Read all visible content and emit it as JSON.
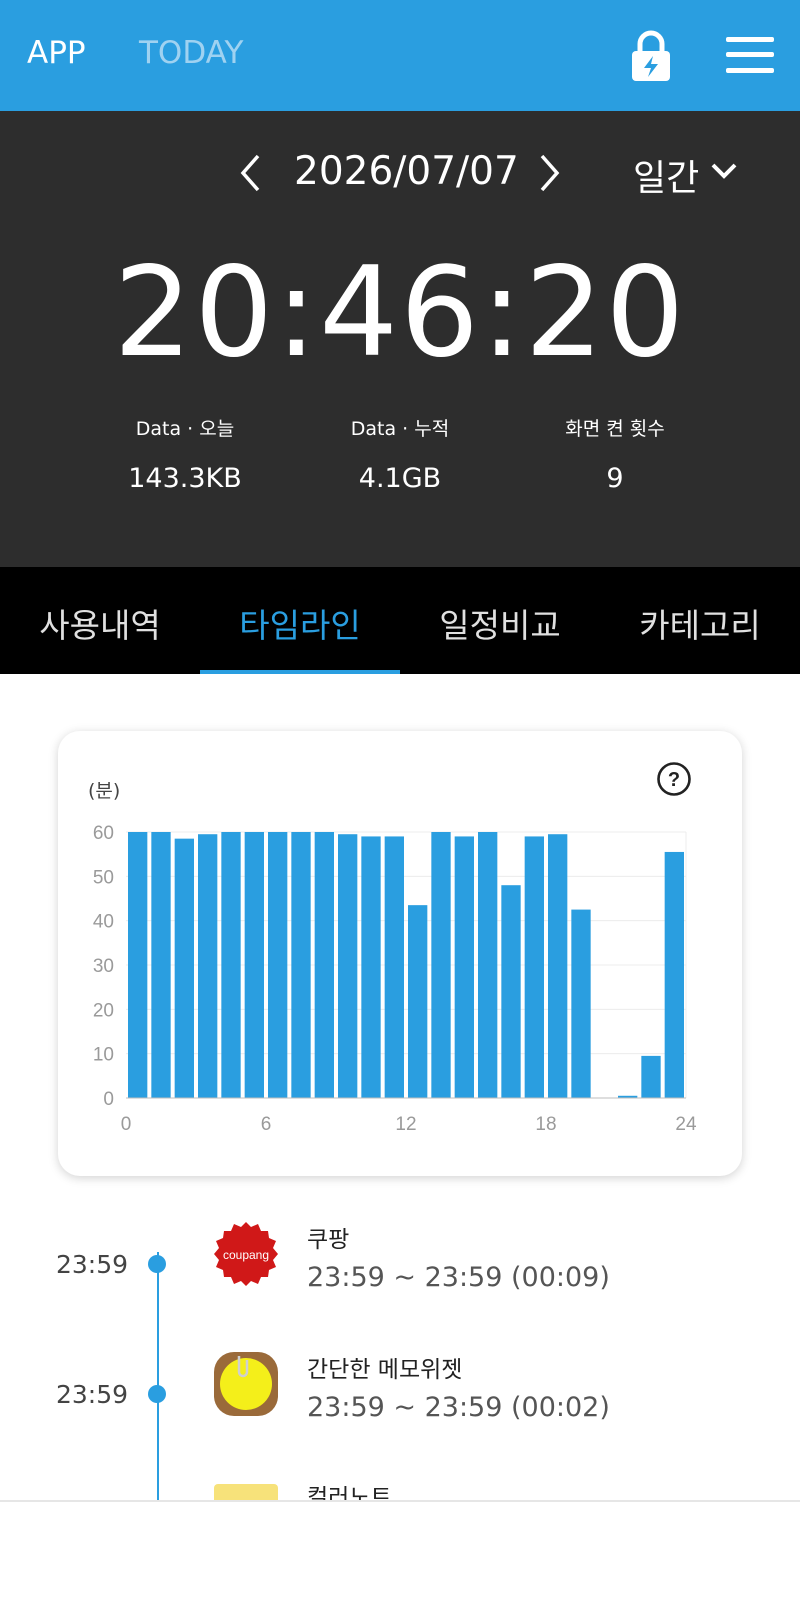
{
  "topbar": {
    "app_label": "APP",
    "today_label": "TODAY",
    "lock_icon": "lock-icon",
    "menu_icon": "menu-icon",
    "color": "#2a9ee0"
  },
  "summary": {
    "date": "2026/07/07",
    "period": "일간",
    "time_total": "20:46:20",
    "stats": [
      {
        "label": "Data · 오늘",
        "value": "143.3KB"
      },
      {
        "label": "Data · 누적",
        "value": "4.1GB"
      },
      {
        "label": "화면 켠 횟수",
        "value": "9"
      }
    ]
  },
  "tabs": [
    {
      "label": "사용내역",
      "active": false
    },
    {
      "label": "타임라인",
      "active": true
    },
    {
      "label": "일정비교",
      "active": false
    },
    {
      "label": "카테고리",
      "active": false
    }
  ],
  "chart_data": {
    "type": "bar",
    "ylabel": "(분)",
    "xlim": [
      0,
      24
    ],
    "ylim": [
      0,
      60
    ],
    "xticks": [
      "0",
      "6",
      "12",
      "18",
      "24"
    ],
    "yticks": [
      "0",
      "10",
      "20",
      "30",
      "40",
      "50",
      "60"
    ],
    "grid": true,
    "color": "#2a9ee0",
    "x": [
      0,
      1,
      2,
      3,
      4,
      5,
      6,
      7,
      8,
      9,
      10,
      11,
      12,
      13,
      14,
      15,
      16,
      17,
      18,
      19,
      20,
      21,
      22,
      23
    ],
    "values": [
      60,
      60,
      58.5,
      59.5,
      60,
      60,
      60,
      60,
      60,
      59.5,
      59,
      59,
      43.5,
      60,
      59,
      60,
      48,
      59,
      59.5,
      42.5,
      0,
      0.5,
      9.5,
      55.5
    ]
  },
  "timeline": [
    {
      "time": "23:59",
      "name": "쿠팡",
      "range": "23:59 ~ 23:59 (00:09)",
      "icon": "coupang-app-icon"
    },
    {
      "time": "23:59",
      "name": "간단한 메모위젯",
      "range": "23:59 ~ 23:59 (00:02)",
      "icon": "memo-widget-app-icon"
    },
    {
      "time": "",
      "name": "컬러노트",
      "range": "",
      "icon": "colornote-app-icon"
    }
  ]
}
